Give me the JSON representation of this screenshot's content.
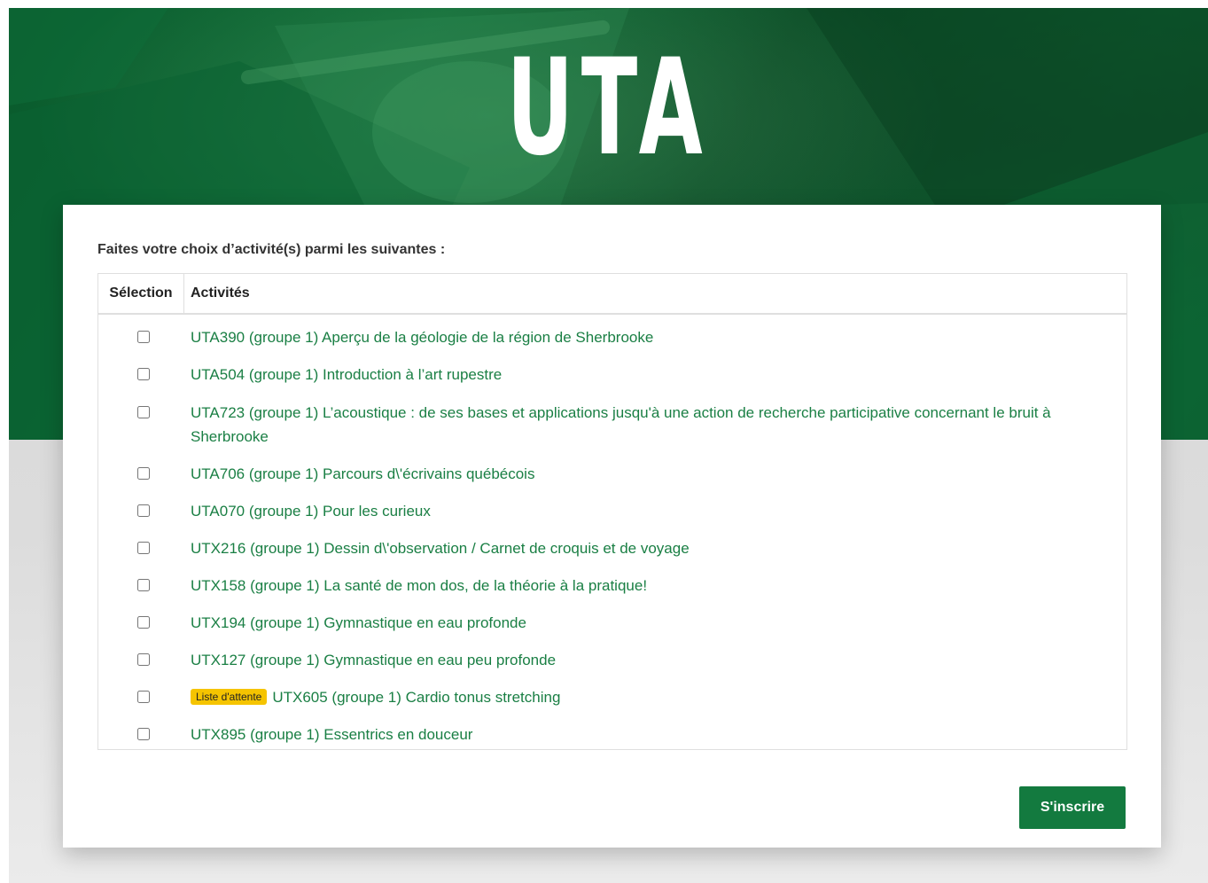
{
  "header": {
    "title": "UTA"
  },
  "form": {
    "intro": "Faites votre choix d’activité(s) parmi les suivantes :",
    "table": {
      "col_selection": "Sélection",
      "col_activities": "Activités"
    },
    "activities": [
      {
        "label": "UTA390 (groupe 1) Aperçu de la géologie de la région de Sherbrooke",
        "checked": false
      },
      {
        "label": "UTA504 (groupe 1) Introduction à l’art rupestre",
        "checked": false
      },
      {
        "label": "UTA723 (groupe 1) L’acoustique : de ses bases et applications jusqu'à une action de recherche participative concernant le bruit à Sherbrooke",
        "checked": false
      },
      {
        "label": "UTA706 (groupe 1) Parcours d\\'écrivains québécois",
        "checked": false
      },
      {
        "label": "UTA070 (groupe 1) Pour les curieux",
        "checked": false
      },
      {
        "label": "UTX216 (groupe 1) Dessin d\\'observation / Carnet de croquis et de voyage",
        "checked": false
      },
      {
        "label": "UTX158 (groupe 1) La santé de mon dos, de la théorie à la pratique!",
        "checked": false
      },
      {
        "label": "UTX194 (groupe 1) Gymnastique en eau profonde",
        "checked": false
      },
      {
        "label": "UTX127 (groupe 1) Gymnastique en eau peu profonde",
        "checked": false
      },
      {
        "label": "UTX605 (groupe 1) Cardio tonus stretching",
        "badge": "Liste d'attente",
        "checked": false
      },
      {
        "label": "UTX895 (groupe 1) Essentrics en douceur",
        "checked": false
      }
    ],
    "submit_label": "S'inscrire"
  },
  "colors": {
    "brand_green": "#137a3f",
    "link_green": "#1a7f44",
    "badge_yellow": "#f5c400"
  }
}
